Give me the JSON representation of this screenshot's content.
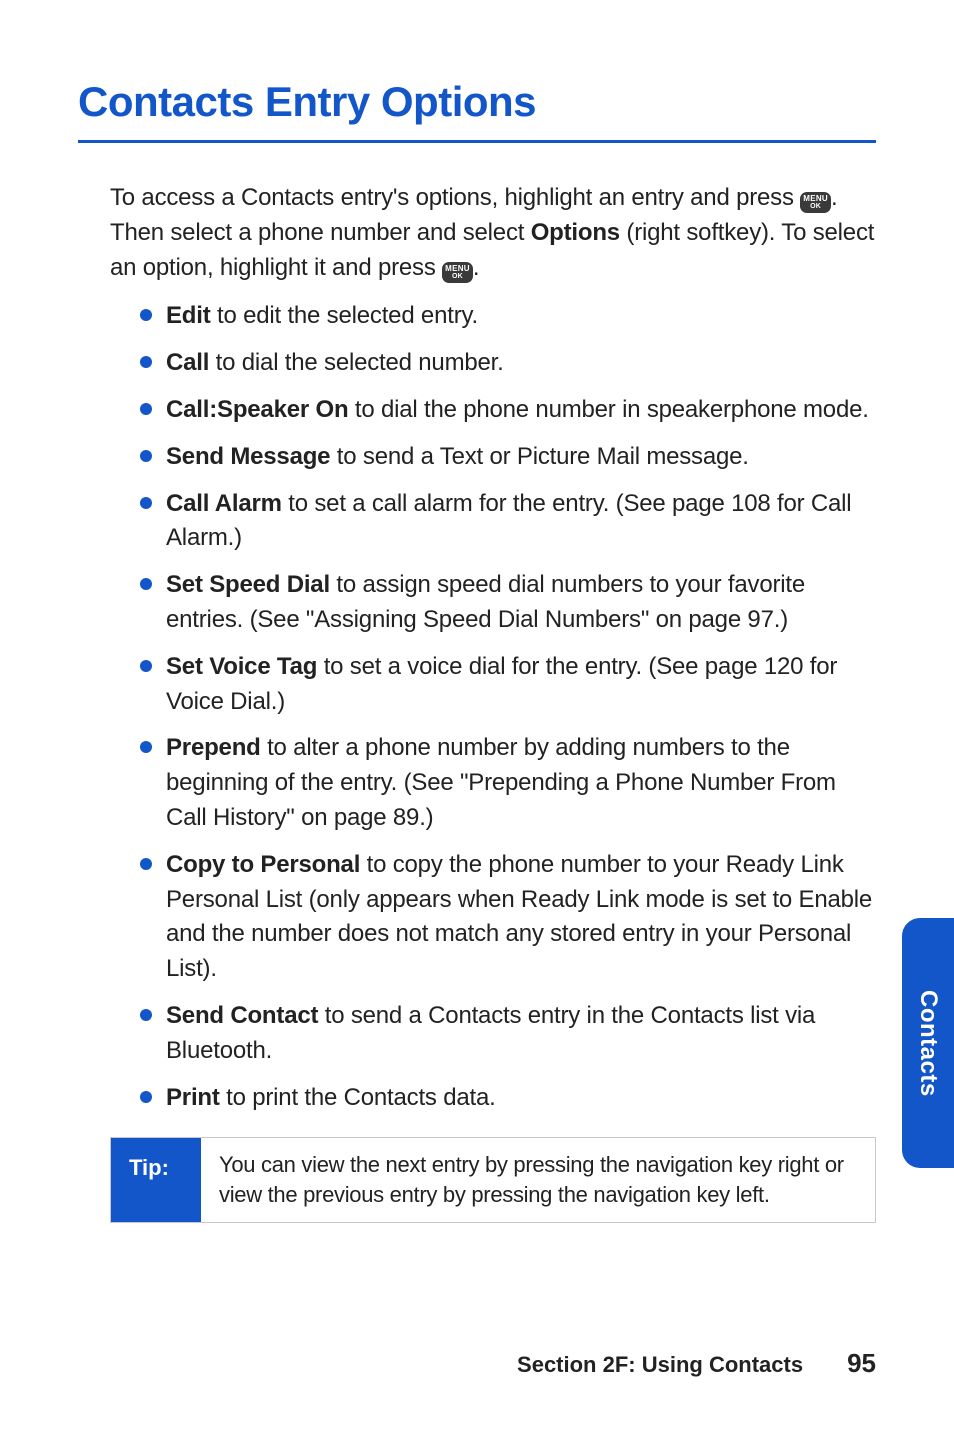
{
  "heading": "Contacts Entry Options",
  "intro": {
    "seg1": "To access a Contacts entry's options, highlight an entry and press ",
    "icon1_name": "menu-ok-icon",
    "seg2": ". Then select a phone number and select ",
    "bold1": "Options",
    "seg3": " (right softkey). To select an option, highlight it and press ",
    "icon2_name": "menu-ok-icon",
    "seg4": "."
  },
  "options": [
    {
      "label": "Edit",
      "text": " to edit the selected entry."
    },
    {
      "label": "Call",
      "text": " to dial the selected number."
    },
    {
      "label": "Call:Speaker On",
      "text": " to dial the phone number in speakerphone mode."
    },
    {
      "label": "Send Message",
      "text": " to send a Text or Picture Mail message."
    },
    {
      "label": "Call Alarm",
      "text": " to set a call alarm for the entry. (See page 108 for Call Alarm.)"
    },
    {
      "label": "Set Speed Dial",
      "text": " to assign speed dial numbers to your favorite entries. (See \"Assigning Speed Dial Numbers\" on page 97.)"
    },
    {
      "label": "Set Voice Tag",
      "text": " to set a voice dial for the entry. (See page 120 for Voice Dial.)"
    },
    {
      "label": "Prepend",
      "text": " to alter a phone number by adding numbers to the beginning of the entry. (See \"Prepending a Phone Number From Call History\" on page 89.)"
    },
    {
      "label": "Copy to Personal",
      "text": " to copy the phone number to your Ready Link Personal List (only appears when Ready Link mode is set to Enable and the number does not match any stored entry in your Personal List)."
    },
    {
      "label": "Send Contact",
      "text": " to send a Contacts entry in the Contacts list via Bluetooth."
    },
    {
      "label": "Print",
      "text": " to print the Contacts data."
    }
  ],
  "tip": {
    "label": "Tip:",
    "text": "You can view the next entry by pressing the navigation key right or view the previous entry by pressing the navigation key left."
  },
  "side_tab": "Contacts",
  "footer": {
    "section": "Section 2F: Using Contacts",
    "page": "95"
  },
  "icon_text": {
    "line1": "MENU",
    "line2": "OK"
  }
}
